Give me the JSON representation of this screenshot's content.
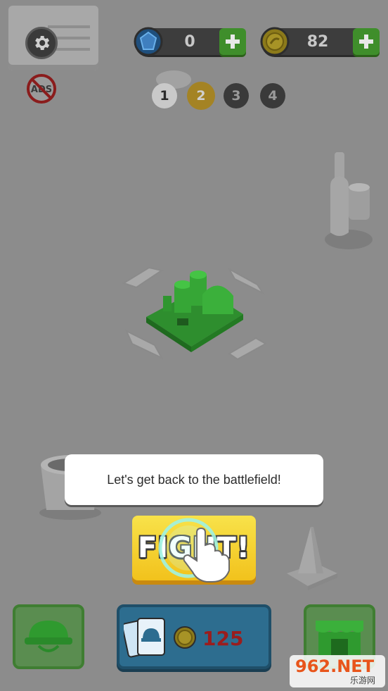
{
  "currency": {
    "gems": {
      "value": "0",
      "icon": "gem-icon"
    },
    "coins": {
      "value": "82",
      "icon": "coin-icon"
    }
  },
  "levels": [
    {
      "label": "1",
      "state": "completed"
    },
    {
      "label": "2",
      "state": "current"
    },
    {
      "label": "3",
      "state": "locked"
    },
    {
      "label": "4",
      "state": "locked"
    }
  ],
  "no_ads_label": "ADS",
  "tooltip_text": "Let's get back to the battlefield!",
  "fight_label": "FIGHT!",
  "card_pack": {
    "price": "125",
    "icon": "card-pack-icon"
  },
  "watermark": {
    "top": "962.NET",
    "bottom": "乐游网"
  },
  "colors": {
    "background": "#8c8c8c",
    "fight_button": "#f2c21c",
    "plus_button": "#3f8e2b",
    "card_button": "#2d6d8f",
    "price_text": "#9a1d1d",
    "base_green": "#2f9a2f"
  }
}
